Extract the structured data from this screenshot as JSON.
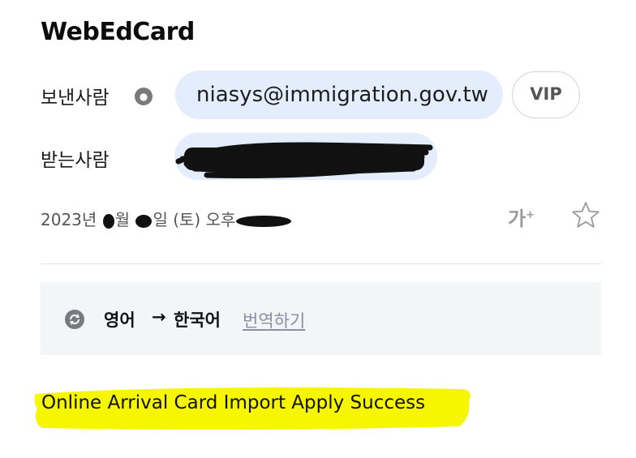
{
  "header": {
    "title": "WebEdCard"
  },
  "sender": {
    "label": "보낸사람",
    "info_icon": "info-icon",
    "address": "niasys@immigration.gov.tw",
    "vip_label": "VIP"
  },
  "receiver": {
    "label": "받는사람"
  },
  "date": {
    "year": "2023년",
    "month_unit": "월",
    "day_unit": "일",
    "weekday": "(토)",
    "ampm": "오후"
  },
  "toolbar": {
    "font_size_label": "가",
    "font_size_plus": "+",
    "star_icon": "star-icon"
  },
  "translate": {
    "icon": "translate-icon",
    "from": "영어",
    "arrow": "→",
    "to": "한국어",
    "action": "번역하기"
  },
  "message": {
    "body": "Online Arrival Card Import Apply Success",
    "highlight_color": "#f6f600"
  },
  "colors": {
    "chip_bg": "#e3edfb",
    "bar_bg": "#f4f5f7"
  }
}
